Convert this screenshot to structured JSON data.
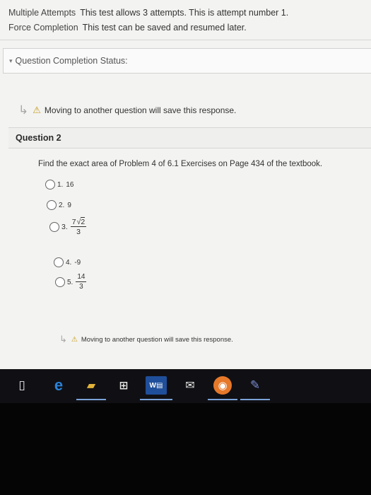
{
  "test_info": [
    {
      "label": "Multiple Attempts",
      "value": "This test allows 3 attempts. This is attempt number 1."
    },
    {
      "label": "Force Completion",
      "value": "This test can be saved and resumed later."
    }
  ],
  "status_bar": {
    "label": "Question Completion Status:"
  },
  "warning_text": "Moving to another question will save this response.",
  "question": {
    "title": "Question 2",
    "text": "Find the exact area of Problem 4 of 6.1 Exercises on Page 434 of the textbook.",
    "options": [
      {
        "number": "1.",
        "value": "16"
      },
      {
        "number": "2.",
        "value": "9"
      },
      {
        "number": "3.",
        "numerator_coefficient": "7",
        "numerator_radicand": "2",
        "denominator": "3"
      },
      {
        "number": "4.",
        "value": "-9"
      },
      {
        "number": "5.",
        "numerator": "14",
        "denominator": "3"
      }
    ]
  },
  "colors": {
    "warning_icon": "#c69a18",
    "taskbar": "#101014",
    "page_bg": "#f3f3f1"
  },
  "taskbar_icons": [
    "tablet-mode-icon",
    "edge-browser-icon",
    "file-explorer-icon",
    "store-icon",
    "word-icon",
    "mail-icon",
    "firefox-icon",
    "paint-icon"
  ]
}
